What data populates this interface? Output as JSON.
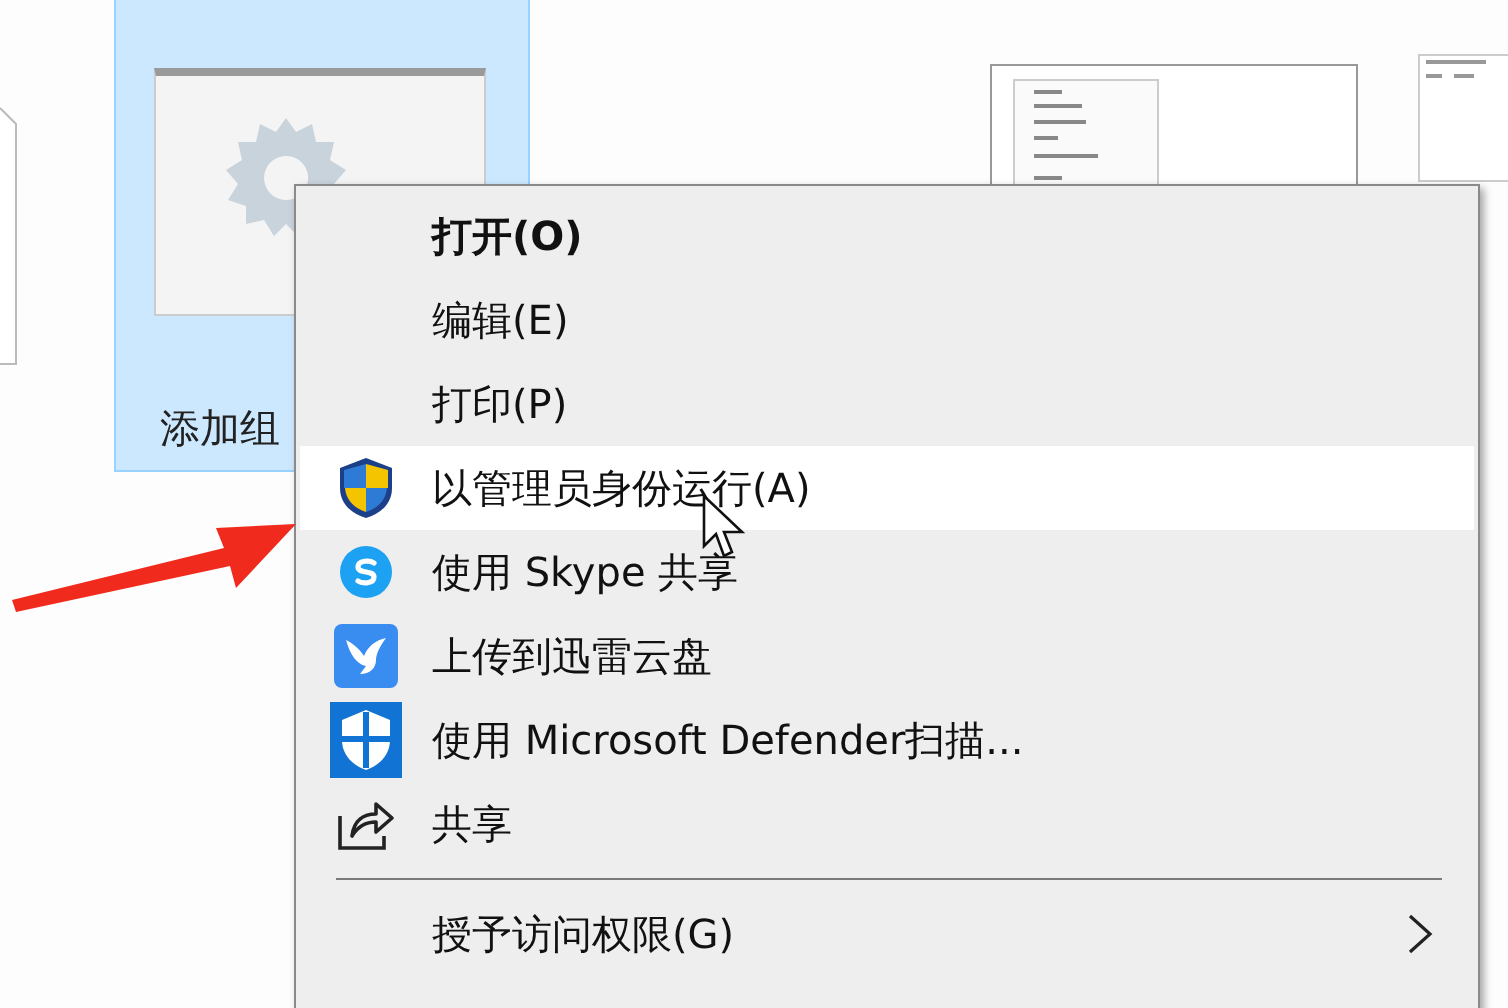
{
  "desktop": {
    "selected_file": {
      "label": "添加组",
      "selected": true
    }
  },
  "context_menu": {
    "items": [
      {
        "kind": "item",
        "label": "打开(O)",
        "bold": true,
        "hovered": false
      },
      {
        "kind": "item",
        "label": "编辑(E)",
        "bold": false,
        "hovered": false
      },
      {
        "kind": "item",
        "label": "打印(P)",
        "bold": false,
        "hovered": false
      },
      {
        "kind": "item",
        "label": "以管理员身份运行(A)",
        "bold": false,
        "hovered": true
      },
      {
        "kind": "item",
        "label": "使用 Skype 共享",
        "bold": false,
        "hovered": false
      },
      {
        "kind": "item",
        "label": "上传到迅雷云盘",
        "bold": false,
        "hovered": false
      },
      {
        "kind": "item",
        "label": "使用 Microsoft Defender扫描...",
        "bold": false,
        "hovered": false
      },
      {
        "kind": "item",
        "label": "共享",
        "bold": false,
        "hovered": false
      },
      {
        "kind": "separator"
      },
      {
        "kind": "item",
        "label": "授予访问权限(G)",
        "bold": false,
        "hovered": false,
        "submenu": true
      }
    ]
  }
}
